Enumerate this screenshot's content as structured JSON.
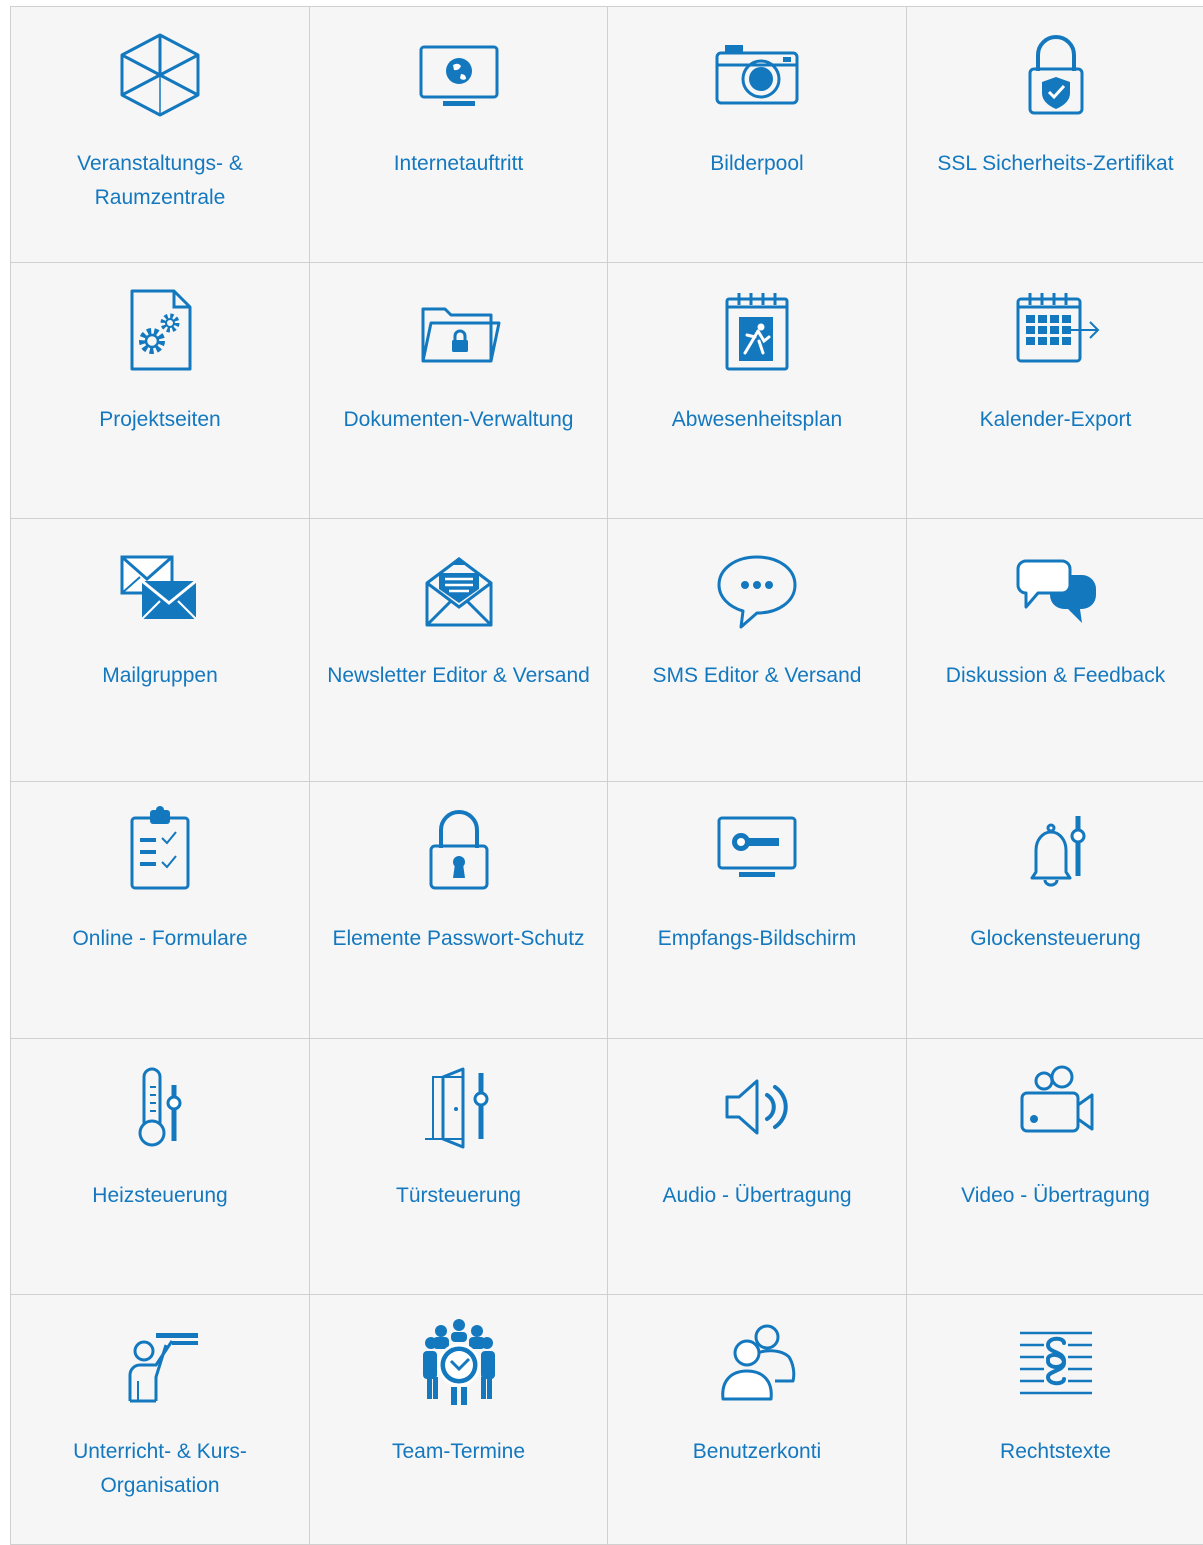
{
  "accent_color": "#1478bf",
  "tiles": [
    {
      "label": "Veranstaltungs- & Raumzentrale",
      "icon": "cube-icon"
    },
    {
      "label": "Internetauftritt",
      "icon": "monitor-globe-icon"
    },
    {
      "label": "Bilderpool",
      "icon": "camera-icon"
    },
    {
      "label": "SSL Sicherheits-Zertifikat",
      "icon": "padlock-shield-icon"
    },
    {
      "label": "Projektseiten",
      "icon": "document-gears-icon"
    },
    {
      "label": "Dokumenten-Verwaltung",
      "icon": "folder-lock-icon"
    },
    {
      "label": "Abwesenheitsplan",
      "icon": "calendar-exit-icon"
    },
    {
      "label": "Kalender-Export",
      "icon": "calendar-export-icon"
    },
    {
      "label": "Mailgruppen",
      "icon": "envelopes-icon"
    },
    {
      "label": "Newsletter Editor & Versand",
      "icon": "newsletter-envelope-icon"
    },
    {
      "label": "SMS Editor & Versand",
      "icon": "speech-bubble-icon"
    },
    {
      "label": "Diskussion & Feedback",
      "icon": "chat-bubbles-icon"
    },
    {
      "label": "Online - Formulare",
      "icon": "clipboard-checklist-icon"
    },
    {
      "label": "Elemente Passwort-Schutz",
      "icon": "padlock-icon"
    },
    {
      "label": "Empfangs-Bildschirm",
      "icon": "monitor-key-icon"
    },
    {
      "label": "Glockensteuerung",
      "icon": "bell-control-icon"
    },
    {
      "label": "Heizsteuerung",
      "icon": "thermometer-control-icon"
    },
    {
      "label": "Türsteuerung",
      "icon": "door-control-icon"
    },
    {
      "label": "Audio - Übertragung",
      "icon": "speaker-icon"
    },
    {
      "label": "Video - Übertragung",
      "icon": "video-camera-icon"
    },
    {
      "label": "Unterricht- & Kurs-Organisation",
      "icon": "teacher-board-icon"
    },
    {
      "label": "Team-Termine",
      "icon": "team-clock-icon"
    },
    {
      "label": "Benutzerkonti",
      "icon": "users-icon"
    },
    {
      "label": "Rechtstexte",
      "icon": "paragraph-lines-icon"
    }
  ]
}
